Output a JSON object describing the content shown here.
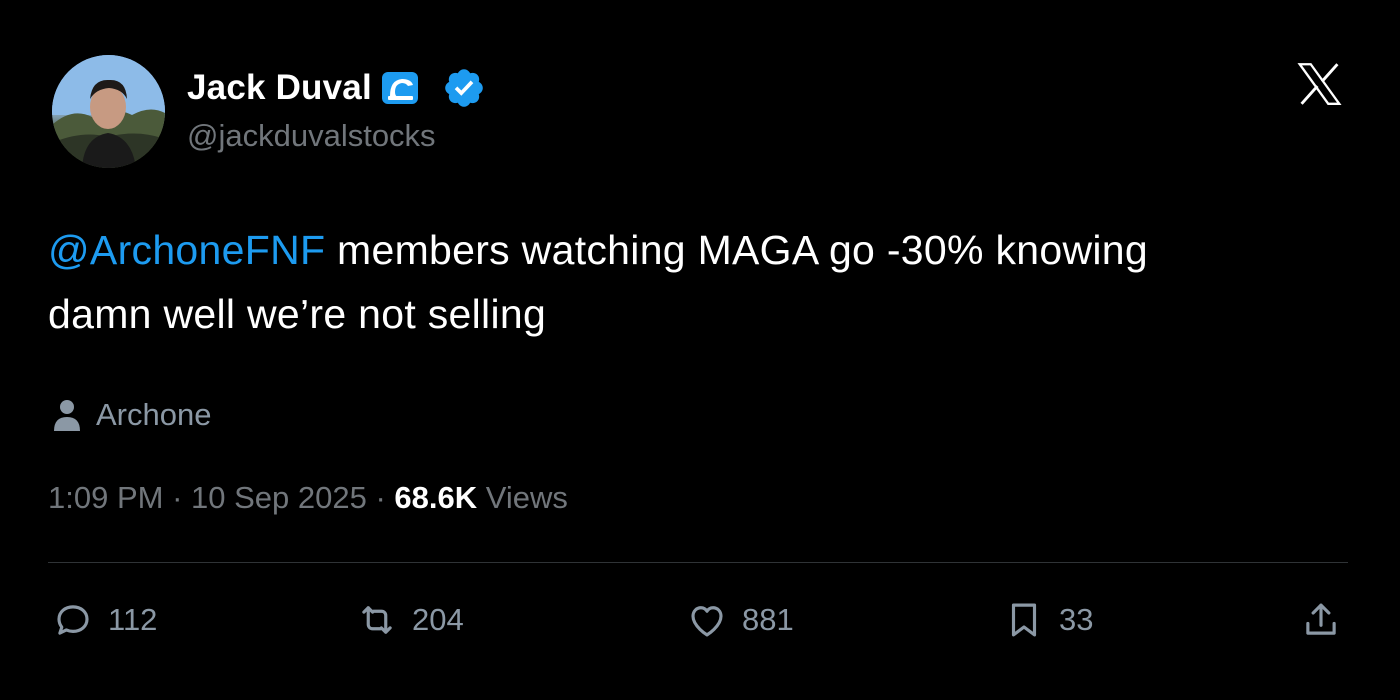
{
  "author": {
    "display_name": "Jack Duval",
    "handle": "@jackduvalstocks"
  },
  "tweet": {
    "mention": "@ArchoneFNF",
    "text_line1": " members watching MAGA go -30% knowing",
    "text_line2": "damn well we’re not selling"
  },
  "community": {
    "name": "Archone",
    "icon": "person-icon"
  },
  "meta": {
    "time": "1:09 PM",
    "sep1": " · ",
    "date": "10 Sep 2025",
    "sep2": " · ",
    "views_count": "68.6K",
    "views_label": " Views"
  },
  "actions": {
    "replies": "112",
    "reposts": "204",
    "likes": "881",
    "bookmarks": "33"
  },
  "colors": {
    "background": "#000000",
    "mention": "#1d9bf0",
    "secondary_text": "#71767b",
    "verified": "#1d9bf0"
  }
}
